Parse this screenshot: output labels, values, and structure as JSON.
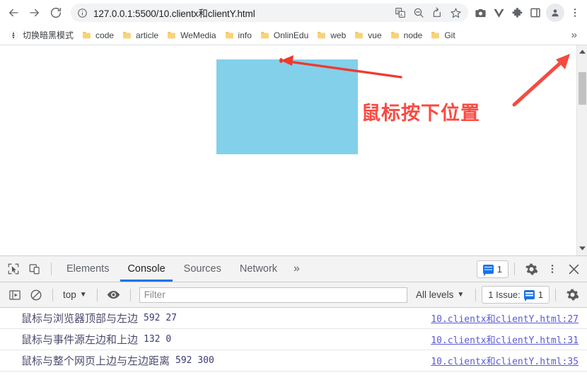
{
  "browser": {
    "nav": {
      "back": "back-arrow",
      "forward": "forward-arrow",
      "reload": "reload"
    },
    "omnibox": {
      "url": "127.0.0.1:5500/10.clientx和clientY.html",
      "info_icon": "info-circle-icon",
      "icons": [
        "translate-icon",
        "zoom-out-icon",
        "share-icon",
        "bookmark-star-icon"
      ]
    },
    "toolbar_icons": [
      "camera-icon",
      "vue-devtools-icon",
      "extensions-puzzle-icon",
      "side-panel-icon"
    ],
    "profile": "profile-avatar",
    "menu": "chrome-menu-icon"
  },
  "bookmarks": {
    "items": [
      {
        "label": "切换暗黑模式",
        "icon": "globe-icon"
      },
      {
        "label": "code",
        "icon": "folder-icon"
      },
      {
        "label": "article",
        "icon": "folder-icon"
      },
      {
        "label": "WeMedia",
        "icon": "folder-icon"
      },
      {
        "label": "info",
        "icon": "folder-icon"
      },
      {
        "label": "OnlinEdu",
        "icon": "folder-icon"
      },
      {
        "label": "web",
        "icon": "folder-icon"
      },
      {
        "label": "vue",
        "icon": "folder-icon"
      },
      {
        "label": "node",
        "icon": "folder-icon"
      },
      {
        "label": "Git",
        "icon": "folder-icon"
      }
    ],
    "overflow": "»"
  },
  "page": {
    "box_color": "#83d0ea",
    "annotation_color": "#fb4a41",
    "annotation_text": "鼠标按下位置",
    "marker": "red-dot-mouse-press-point"
  },
  "devtools": {
    "tabs": [
      {
        "label": "Elements",
        "active": false
      },
      {
        "label": "Console",
        "active": true
      },
      {
        "label": "Sources",
        "active": false
      },
      {
        "label": "Network",
        "active": false
      }
    ],
    "tabs_overflow": "»",
    "inspect_icon": "inspect-element-icon",
    "device_icon": "device-toolbar-icon",
    "issues_count": "1",
    "settings_icon": "settings-gear-icon",
    "more_icon": "more-vertical-icon",
    "close_icon": "close-icon",
    "filterbar": {
      "sidebar_icon": "console-sidebar-icon",
      "clear_icon": "clear-console-icon",
      "context": "top",
      "eye_icon": "live-expression-eye-icon",
      "filter_placeholder": "Filter",
      "filter_value": "",
      "levels": "All levels",
      "issues_label": "1 Issue:",
      "issues_count": "1",
      "settings_icon": "settings-gear-icon"
    },
    "console_rows": [
      {
        "text": "鼠标与浏览器顶部与左边",
        "values": "592  27",
        "source": "10.clientx和clientY.html:27"
      },
      {
        "text": "鼠标与事件源左边和上边",
        "values": "132  0",
        "source": "10.clientx和clientY.html:31"
      },
      {
        "text": "鼠标与整个网页上边与左边距离",
        "values": "592  300",
        "source": "10.clientx和clientY.html:35"
      }
    ]
  }
}
